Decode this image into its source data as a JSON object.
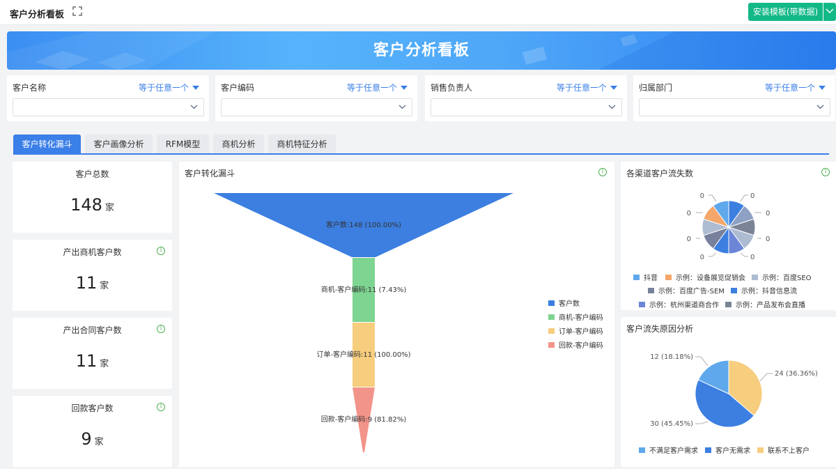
{
  "header": {
    "title": "客户分析看板",
    "install_label": "安装模板(带数据)"
  },
  "banner": {
    "title": "客户分析看板"
  },
  "filters": [
    {
      "label": "客户名称",
      "op": "等于任意一个"
    },
    {
      "label": "客户编码",
      "op": "等于任意一个"
    },
    {
      "label": "销售负责人",
      "op": "等于任意一个"
    },
    {
      "label": "归属部门",
      "op": "等于任意一个"
    }
  ],
  "tabs": [
    "客户转化漏斗",
    "客户画像分析",
    "RFM模型",
    "商机分析",
    "商机特征分析"
  ],
  "kpis": [
    {
      "label": "客户总数",
      "value": "148",
      "unit": "家"
    },
    {
      "label": "产出商机客户数",
      "value": "11",
      "unit": "家"
    },
    {
      "label": "产出合同客户数",
      "value": "11",
      "unit": "家"
    },
    {
      "label": "回款客户数",
      "value": "9",
      "unit": "家"
    }
  ],
  "funnel": {
    "title": "客户转化漏斗",
    "stages": [
      {
        "label": "客户数:148 (100.00%)",
        "name": "客户数",
        "color": "#3c7fe0"
      },
      {
        "label": "商机-客户编码:11 (7.43%)",
        "name": "商机-客户编码",
        "color": "#7ed491"
      },
      {
        "label": "订单-客户编码:11 (100.00%)",
        "name": "订单-客户编码",
        "color": "#f7cd7e"
      },
      {
        "label": "回款-客户编码:9 (81.82%)",
        "name": "回款-客户编码",
        "color": "#f2948a"
      }
    ]
  },
  "churn_channels": {
    "title": "各渠道客户流失数",
    "labels": [
      "0",
      "0",
      "0",
      "0",
      "0",
      "0",
      "0",
      "0",
      "0",
      "0"
    ],
    "legend": [
      {
        "name": "抖音",
        "color": "#5fa8ec"
      },
      {
        "name": "示例：设备展览促销会",
        "color": "#f4a66b"
      },
      {
        "name": "示例：百度SEO",
        "color": "#aebcd2"
      },
      {
        "name": "示例：百度广告-SEM",
        "color": "#77819b"
      },
      {
        "name": "示例：抖音信息流",
        "color": "#3c7fe0"
      },
      {
        "name": "示例：杭州渠道商合作",
        "color": "#6b86d6"
      },
      {
        "name": "示例：产品发布会直播",
        "color": "#7b8496"
      }
    ]
  },
  "churn_reasons": {
    "title": "客户流失原因分析",
    "chart_data": {
      "type": "pie",
      "categories": [
        "不满足客户需求",
        "客户无需求",
        "联系不上客户"
      ],
      "values": [
        12,
        30,
        24
      ],
      "labels": [
        "12 (18.18%)",
        "30 (45.45%)",
        "24 (36.36%)"
      ]
    },
    "colors": [
      "#5fa8ec",
      "#3c7fe0",
      "#f7cd7e"
    ]
  }
}
